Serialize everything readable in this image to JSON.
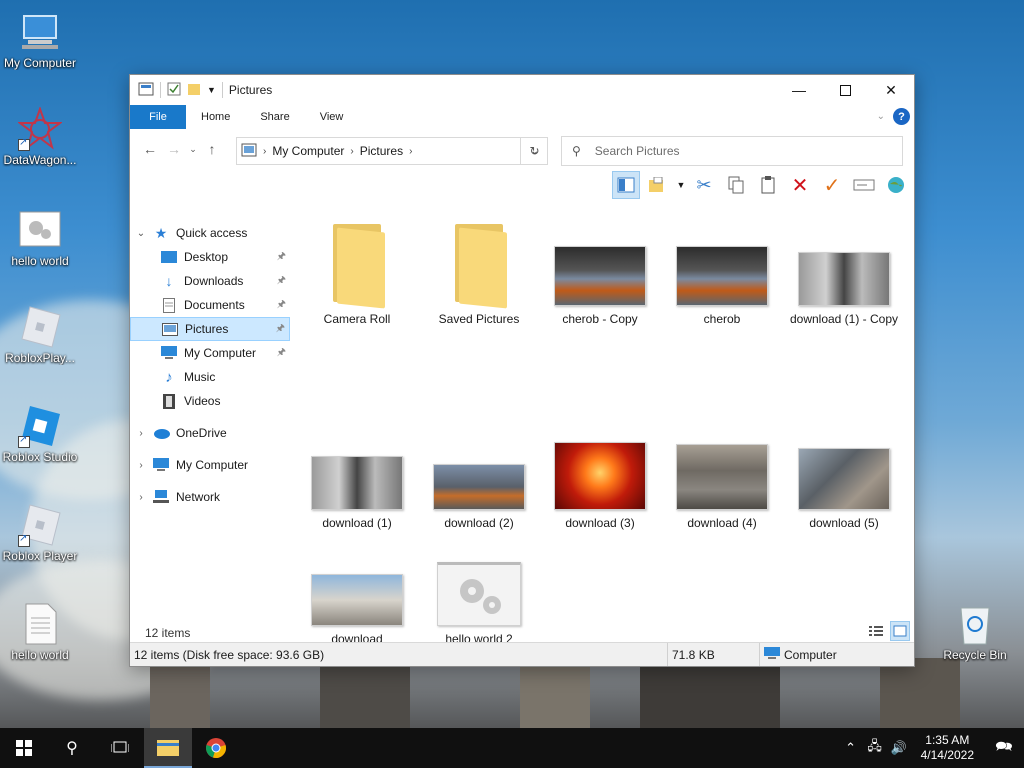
{
  "desktop": {
    "icons": [
      {
        "label": "My Computer",
        "icon": "computer-icon"
      },
      {
        "label": "DataWagon...",
        "icon": "datawagon-icon"
      },
      {
        "label": "hello world",
        "icon": "gear-image-icon"
      },
      {
        "label": "RobloxPlay...",
        "icon": "roblox-player-icon"
      },
      {
        "label": "Roblox Studio",
        "icon": "roblox-studio-icon"
      },
      {
        "label": "Roblox Player",
        "icon": "roblox-player-icon"
      },
      {
        "label": "hello world",
        "icon": "text-file-icon"
      },
      {
        "label": "Recycle Bin",
        "icon": "recycle-bin-icon"
      }
    ]
  },
  "window": {
    "title": "Pictures",
    "ribbon_tabs": [
      "File",
      "Home",
      "Share",
      "View"
    ],
    "breadcrumb": [
      "My Computer",
      "Pictures"
    ],
    "search_placeholder": "Search Pictures",
    "nav": {
      "quick_access": "Quick access",
      "quick_items": [
        {
          "label": "Desktop",
          "icon": "desktop-icon",
          "pinned": true
        },
        {
          "label": "Downloads",
          "icon": "downloads-icon",
          "pinned": true
        },
        {
          "label": "Documents",
          "icon": "documents-icon",
          "pinned": true
        },
        {
          "label": "Pictures",
          "icon": "pictures-icon",
          "pinned": true,
          "selected": true
        },
        {
          "label": "My Computer",
          "icon": "computer-icon",
          "pinned": true
        },
        {
          "label": "Music",
          "icon": "music-icon",
          "pinned": false
        },
        {
          "label": "Videos",
          "icon": "videos-icon",
          "pinned": false
        }
      ],
      "onedrive": "OneDrive",
      "this_pc": "My Computer",
      "network": "Network"
    },
    "items": [
      {
        "name": "Camera Roll",
        "kind": "folder"
      },
      {
        "name": "Saved Pictures",
        "kind": "folder"
      },
      {
        "name": "cherob - Copy",
        "kind": "photo"
      },
      {
        "name": "cherob",
        "kind": "photo"
      },
      {
        "name": "download (1) - Copy",
        "kind": "photo"
      },
      {
        "name": "download (1)",
        "kind": "photo"
      },
      {
        "name": "download (2)",
        "kind": "photo"
      },
      {
        "name": "download (3)",
        "kind": "photo"
      },
      {
        "name": "download (4)",
        "kind": "photo"
      },
      {
        "name": "download (5)",
        "kind": "photo"
      },
      {
        "name": "download",
        "kind": "photo"
      },
      {
        "name": "hello world 2",
        "kind": "gear-image"
      }
    ],
    "item_count": "12 items",
    "status": {
      "summary": "12 items (Disk free space: 93.6 GB)",
      "size": "71.8 KB",
      "location": "Computer"
    }
  },
  "taskbar": {
    "time": "1:35 AM",
    "date": "4/14/2022"
  }
}
